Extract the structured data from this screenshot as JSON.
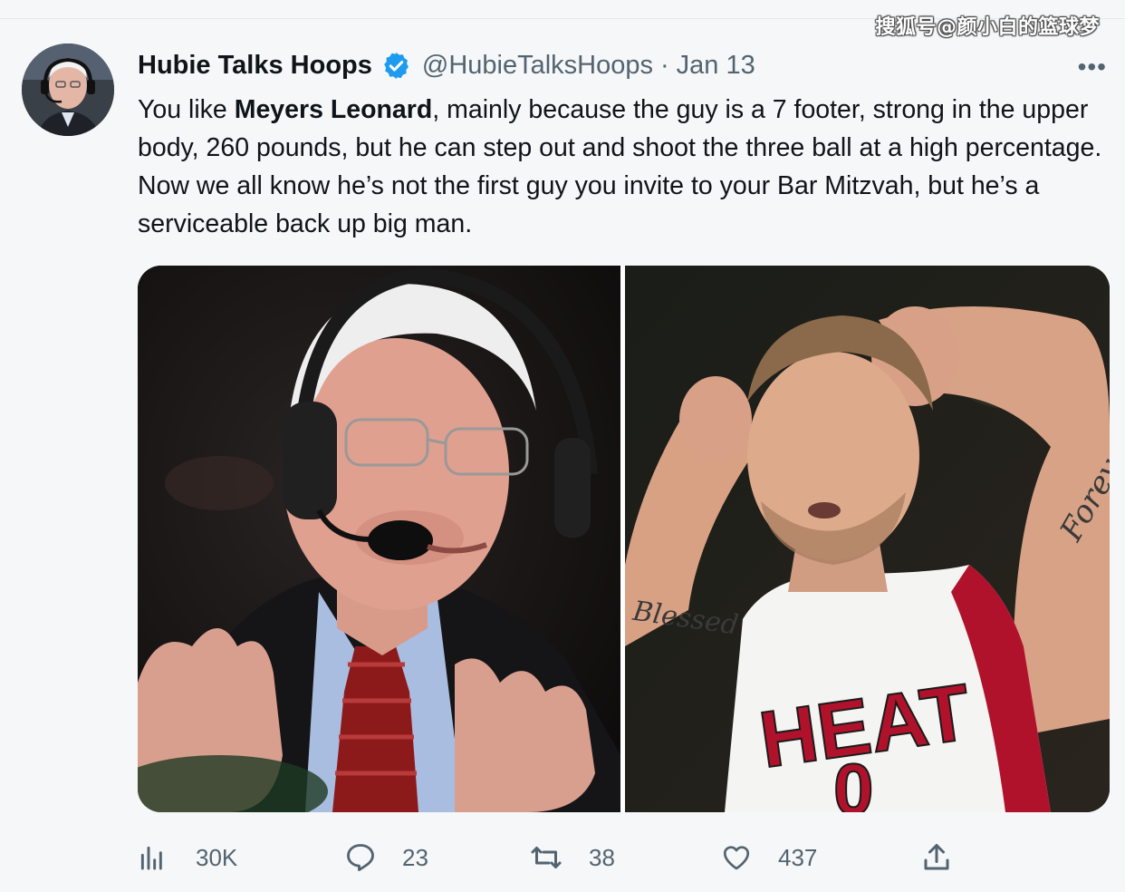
{
  "watermark": "搜狐号@颜小白的篮球梦",
  "tweet": {
    "author_name": "Hubie Talks Hoops",
    "handle": "@HubieTalksHoops",
    "separator": "·",
    "date": "Jan 13",
    "more_label": "•••",
    "text_part1": "You like ",
    "text_bold": "Meyers Leonard",
    "text_part2": ", mainly because the guy is a 7 footer, strong in the upper body, 260 pounds, but he can step out and shoot the three ball at a high percentage. Now we all know he’s not the first guy you invite to your Bar Mitzvah, but he’s a serviceable back up big man.",
    "media_left": "photo-commentator-headset",
    "media_right": "photo-player-heat-jersey",
    "jersey_text": "HEAT",
    "jersey_number": "0",
    "tattoo_arm_left": "Blessed",
    "tattoo_arm_right": "Forever"
  },
  "actions": {
    "views": "30K",
    "replies": "23",
    "retweets": "38",
    "likes": "437"
  },
  "icons": {
    "verified": "verified-badge-icon",
    "views": "analytics-icon",
    "reply": "reply-icon",
    "retweet": "retweet-icon",
    "like": "heart-icon",
    "share": "share-icon"
  },
  "colors": {
    "verified_blue": "#1d9bf0",
    "secondary_text": "#536471",
    "heat_red": "#98002e"
  }
}
